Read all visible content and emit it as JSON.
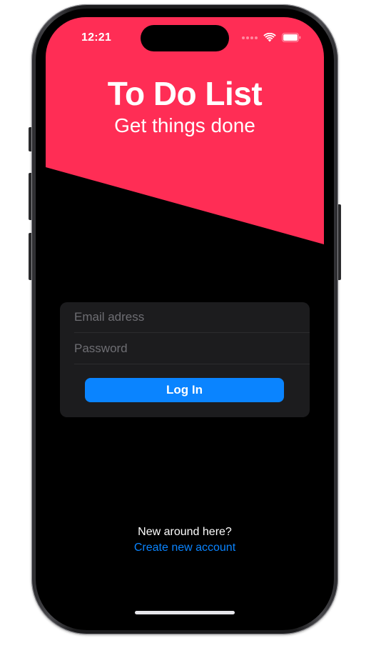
{
  "status_bar": {
    "time": "12:21",
    "icons": [
      "signal-dots-icon",
      "wifi-icon",
      "battery-icon"
    ]
  },
  "header": {
    "title": "To Do List",
    "subtitle": "Get things done",
    "background_color": "#ff2d55"
  },
  "login_form": {
    "email": {
      "value": "",
      "placeholder": "Email adress"
    },
    "password": {
      "value": "",
      "placeholder": "Password"
    },
    "login_label": "Log In",
    "button_color": "#0a84ff"
  },
  "footer": {
    "prompt": "New around here?",
    "create_account_label": "Create new account",
    "link_color": "#0a84ff"
  }
}
